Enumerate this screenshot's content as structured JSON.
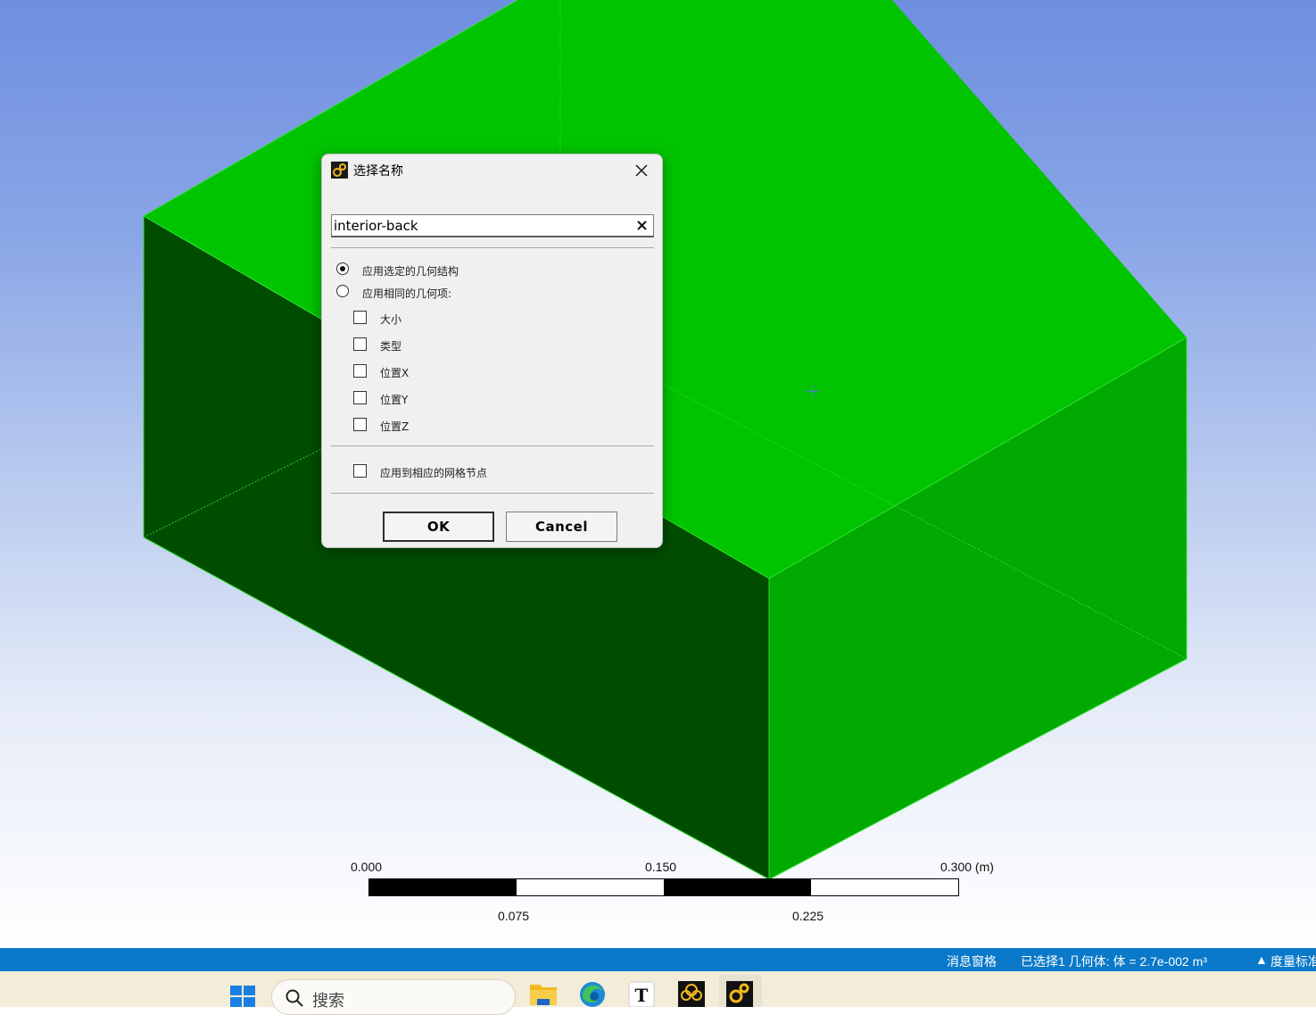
{
  "colors": {
    "accent_status_bar": "#0a79c9",
    "body_top_face": "#00c400",
    "body_left_face": "#004d00",
    "body_right_face": "#00a800",
    "edge": "#3ce43c"
  },
  "dialog": {
    "title": "选择名称",
    "icon": "ansys-mechanical-icon",
    "name_value": "interior-back",
    "options": {
      "apply_selected": "应用选定的几何结构",
      "apply_same": "应用相同的几何项:",
      "size": "大小",
      "type": "类型",
      "location_x": "位置X",
      "location_y": "位置Y",
      "location_z": "位置Z",
      "apply_mesh_nodes": "应用到相应的网格节点"
    },
    "ok_label": "OK",
    "cancel_label": "Cancel"
  },
  "scale": {
    "labels_top": [
      "0.000",
      "0.150",
      "0.300 (m)"
    ],
    "labels_bottom": [
      "0.075",
      "0.225"
    ]
  },
  "status_bar": {
    "messages": "消息窗格",
    "selection": "已选择1 几何体: 体 = 2.7e-002 m³",
    "metric": "度量标准"
  },
  "taskbar": {
    "search_placeholder": "搜索",
    "apps": [
      "file-explorer-icon",
      "edge-icon",
      "typora-icon",
      "ansys-workbench-icon",
      "ansys-mechanical-icon"
    ]
  }
}
